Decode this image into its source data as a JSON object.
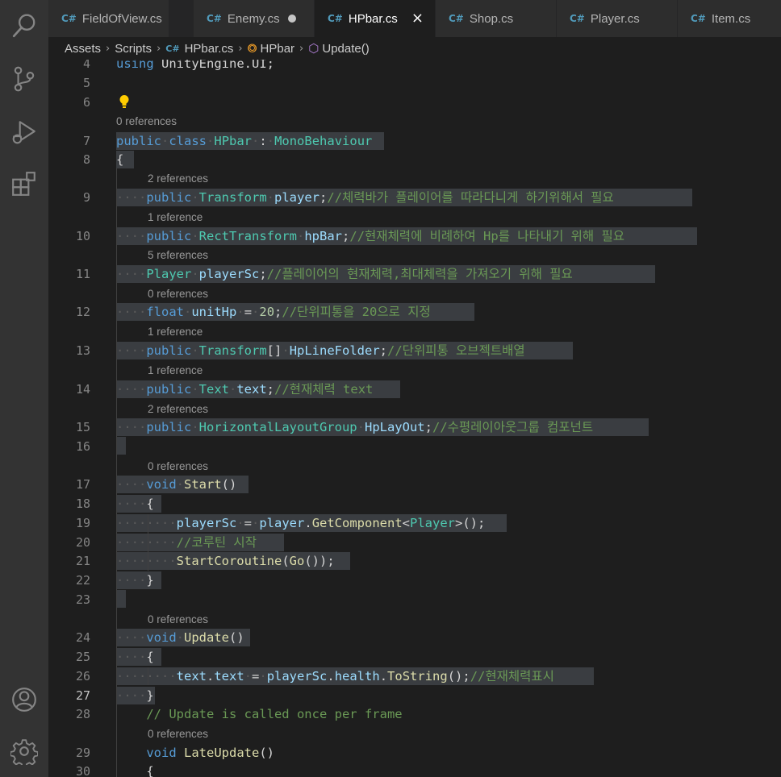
{
  "tabs": [
    {
      "label": "FieldOfView.cs",
      "icon": "csharp-icon"
    },
    {
      "label": "Enemy.cs",
      "icon": "csharp-icon",
      "modified": true
    },
    {
      "label": "HPbar.cs",
      "icon": "csharp-icon",
      "active": true
    },
    {
      "label": "Shop.cs",
      "icon": "csharp-icon"
    },
    {
      "label": "Player.cs",
      "icon": "csharp-icon"
    },
    {
      "label": "Item.cs",
      "icon": "csharp-icon"
    }
  ],
  "tab_close_glyph": "×",
  "breadcrumb": {
    "assets": "Assets",
    "scripts": "Scripts",
    "file": "HPbar.cs",
    "class": "HPbar",
    "method": "Update()"
  },
  "cs_icon_text": "C#",
  "line_numbers": [
    "4",
    "5",
    "6",
    "7",
    "8",
    "9",
    "10",
    "11",
    "12",
    "13",
    "14",
    "15",
    "16",
    "17",
    "18",
    "19",
    "20",
    "21",
    "22",
    "23",
    "24",
    "25",
    "26",
    "27",
    "28",
    "29",
    "30"
  ],
  "code": {
    "l4": {
      "kw": "using",
      "ns": "UnityEngine.UI",
      "end": ";"
    },
    "l7": {
      "kw1": "public",
      "kw2": "class",
      "name": "HPbar",
      "colon": ":",
      "base": "MonoBehaviour"
    },
    "l8": {
      "brace": "{"
    },
    "l9": {
      "kw": "public",
      "type": "Transform",
      "var": "player",
      "end": ";",
      "comment": "//체력바가 플레이어를 따라다니게 하기위해서 필요"
    },
    "l10": {
      "kw": "public",
      "type": "RectTransform",
      "var": "hpBar",
      "end": ";",
      "comment": "//현재체력에 비례하여 Hp를 나타내기 위해 필요"
    },
    "l11": {
      "type": "Player",
      "var": "playerSc",
      "end": ";",
      "comment": "//플레이어의 현재체력,최대체력을 가져오기 위해 필요"
    },
    "l12": {
      "kw": "float",
      "var": "unitHp",
      "eq": "=",
      "num": "20",
      "end": ";",
      "comment": "//단위피통을 20으로 지정"
    },
    "l13": {
      "kw": "public",
      "type": "Transform",
      "arr": "[]",
      "var": "HpLineFolder",
      "end": ";",
      "comment": "//단위피통 오브젝트배열"
    },
    "l14": {
      "kw": "public",
      "type": "Text",
      "var": "text",
      "end": ";",
      "comment": "//현재체력 text"
    },
    "l15": {
      "kw": "public",
      "type": "HorizontalLayoutGroup",
      "var": "HpLayOut",
      "end": ";",
      "comment": "//수평레이아웃그룹 컴포넌트"
    },
    "l17": {
      "kw": "void",
      "fn": "Start",
      "parens": "()"
    },
    "l18": {
      "brace": "{"
    },
    "l19": {
      "var1": "playerSc",
      "eq": "=",
      "var2": "player",
      "dot": ".",
      "fn": "GetComponent",
      "lt": "<",
      "type": "Player",
      "rest": ">();"
    },
    "l20": {
      "comment": "//코루틴 시작"
    },
    "l21": {
      "fn": "StartCoroutine",
      "p1": "(",
      "fn2": "Go",
      "rest": "());"
    },
    "l22": {
      "brace": "}"
    },
    "l24": {
      "kw": "void",
      "fn": "Update",
      "parens": "()"
    },
    "l25": {
      "brace": "{"
    },
    "l26": {
      "var1": "text",
      "dot1": ".",
      "var2": "text",
      "eq": "=",
      "var3": "playerSc",
      "dot2": ".",
      "var4": "health",
      "dot3": ".",
      "fn": "ToString",
      "rest": "();",
      "comment": "//현재체력표시"
    },
    "l27": {
      "brace": "}"
    },
    "l28": {
      "comment": "// Update is called once per frame"
    },
    "l29": {
      "kw": "void",
      "fn": "LateUpdate",
      "parens": "()"
    },
    "l30": {
      "brace": "{"
    }
  },
  "codelens": {
    "class": "0 references",
    "player": "2 references",
    "hpBar": "1 reference",
    "playerSc": "5 references",
    "unitHp": "0 references",
    "HpLineFolder": "1 reference",
    "text": "1 reference",
    "HpLayOut": "2 references",
    "Start": "0 references",
    "Update": "0 references",
    "LateUpdate": "0 references"
  },
  "colors": {
    "keyword": "#569cd6",
    "type": "#4ec9b0",
    "function": "#dcdcaa",
    "variable": "#9cdcfe",
    "number": "#b5cea8",
    "comment": "#6a9955",
    "selection": "#3a3d41",
    "lightbulb": "#ffcc00"
  }
}
